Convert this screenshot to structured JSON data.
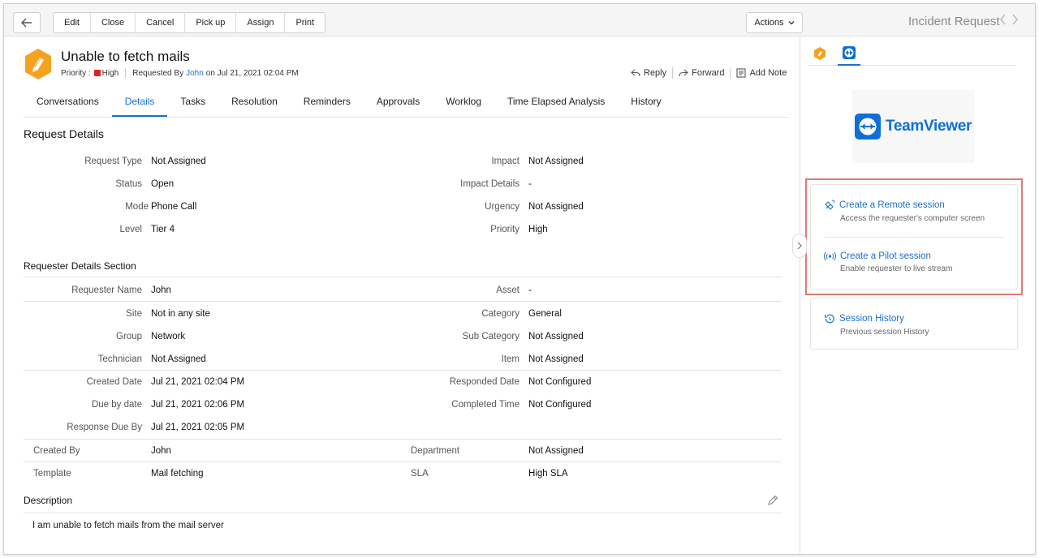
{
  "toolbar": {
    "buttons": [
      "Edit",
      "Close",
      "Cancel",
      "Pick up",
      "Assign",
      "Print"
    ],
    "actions_label": "Actions",
    "record_type": "Incident Request"
  },
  "header": {
    "subject": "Unable to fetch mails",
    "priority_label": "Priority :",
    "priority_value": "High",
    "requested_by_label": "Requested By",
    "requester": "John",
    "requested_on": "on Jul 21, 2021 02:04 PM",
    "reply": "Reply",
    "forward": "Forward",
    "add_note": "Add Note"
  },
  "tabs": [
    "Conversations",
    "Details",
    "Tasks",
    "Resolution",
    "Reminders",
    "Approvals",
    "Worklog",
    "Time Elapsed Analysis",
    "History"
  ],
  "request_details": {
    "title": "Request Details",
    "left": [
      {
        "label": "Request Type",
        "value": "Not Assigned"
      },
      {
        "label": "Status",
        "value": "Open"
      },
      {
        "label": "Mode",
        "value": "Phone Call"
      },
      {
        "label": "Level",
        "value": "Tier 4"
      }
    ],
    "right": [
      {
        "label": "Impact",
        "value": "Not Assigned"
      },
      {
        "label": "Impact Details",
        "value": "-"
      },
      {
        "label": "Urgency",
        "value": "Not Assigned"
      },
      {
        "label": "Priority",
        "value": "High"
      }
    ]
  },
  "requester_details": {
    "title": "Requester Details Section",
    "left": [
      {
        "label": "Requester Name",
        "value": "John"
      },
      {
        "label": "Site",
        "value": "Not in any site"
      },
      {
        "label": "Group",
        "value": "Network"
      },
      {
        "label": "Technician",
        "value": "Not Assigned"
      },
      {
        "label": "Created Date",
        "value": "Jul 21, 2021 02:04 PM"
      },
      {
        "label": "Due by date",
        "value": "Jul 21, 2021 02:06 PM"
      },
      {
        "label": "Response Due By",
        "value": "Jul 21, 2021 02:05 PM"
      }
    ],
    "right": [
      {
        "label": "Asset",
        "value": "-"
      },
      {
        "label": "Category",
        "value": "General"
      },
      {
        "label": "Sub Category",
        "value": "Not Assigned"
      },
      {
        "label": "Item",
        "value": "Not Assigned"
      },
      {
        "label": "Responded Date",
        "value": "Not Configured"
      },
      {
        "label": "Completed Time",
        "value": "Not Configured"
      }
    ]
  },
  "other_fields": [
    {
      "label": "Created By",
      "value": "John"
    },
    {
      "label": "Template",
      "value": "Mail fetching"
    },
    {
      "label": "Department",
      "value": "Not Assigned"
    },
    {
      "label": "SLA",
      "value": "High SLA"
    }
  ],
  "description": {
    "title": "Description",
    "text": "I am unable to fetch mails from the mail server"
  },
  "right_panel": {
    "logo_text": "TeamViewer",
    "remote_session": {
      "title": "Create a Remote session",
      "desc": "Access the requester's computer screen"
    },
    "pilot_session": {
      "title": "Create a Pilot session",
      "desc": "Enable requester to live stream"
    },
    "session_history": {
      "title": "Session History",
      "desc": "Previous session History"
    }
  },
  "colors": {
    "accent": "#1a6fd1",
    "priority_high": "#e02020",
    "highlight_border": "#e07a73",
    "teamviewer_blue": "#0e6fd6",
    "icon_orange": "#f4a21f"
  }
}
